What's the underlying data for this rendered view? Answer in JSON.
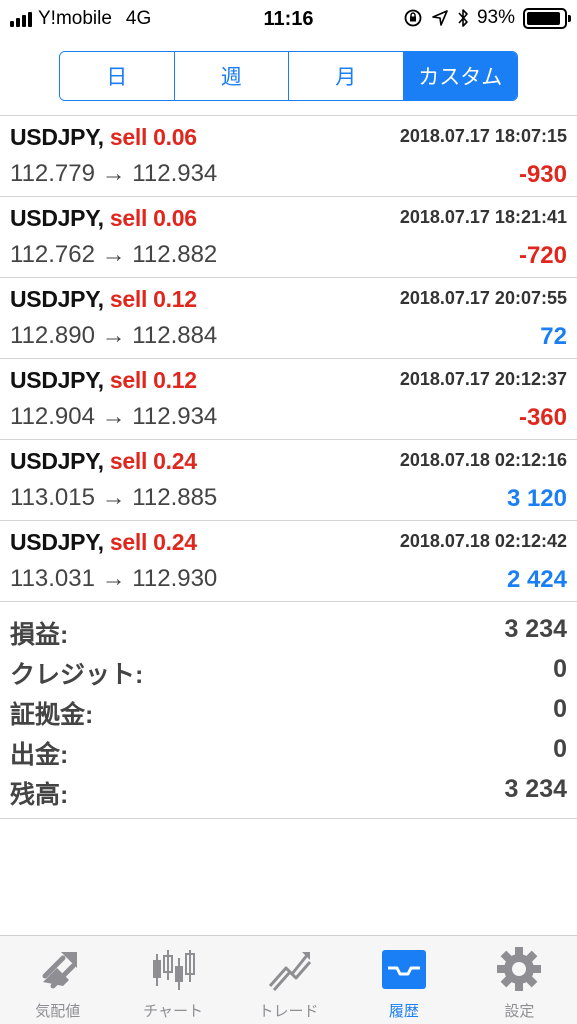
{
  "status_bar": {
    "carrier": "Y!mobile",
    "network": "4G",
    "time": "11:16",
    "battery_percent": "93%",
    "battery_level": 0.93
  },
  "segments": [
    {
      "label": "日",
      "active": false
    },
    {
      "label": "週",
      "active": false
    },
    {
      "label": "月",
      "active": false
    },
    {
      "label": "カスタム",
      "active": true
    }
  ],
  "trades": [
    {
      "symbol": "USDJPY,",
      "side": "sell 0.06",
      "datetime": "2018.07.17 18:07:15",
      "prices": "112.779 → 112.934",
      "profit": "-930",
      "profit_sign": "neg"
    },
    {
      "symbol": "USDJPY,",
      "side": "sell 0.06",
      "datetime": "2018.07.17 18:21:41",
      "prices": "112.762 → 112.882",
      "profit": "-720",
      "profit_sign": "neg"
    },
    {
      "symbol": "USDJPY,",
      "side": "sell 0.12",
      "datetime": "2018.07.17 20:07:55",
      "prices": "112.890 → 112.884",
      "profit": "72",
      "profit_sign": "pos"
    },
    {
      "symbol": "USDJPY,",
      "side": "sell 0.12",
      "datetime": "2018.07.17 20:12:37",
      "prices": "112.904 → 112.934",
      "profit": "-360",
      "profit_sign": "neg"
    },
    {
      "symbol": "USDJPY,",
      "side": "sell 0.24",
      "datetime": "2018.07.18 02:12:16",
      "prices": "113.015 → 112.885",
      "profit": "3 120",
      "profit_sign": "pos"
    },
    {
      "symbol": "USDJPY,",
      "side": "sell 0.24",
      "datetime": "2018.07.18 02:12:42",
      "prices": "113.031 → 112.930",
      "profit": "2 424",
      "profit_sign": "pos"
    }
  ],
  "summary": [
    {
      "label": "損益:",
      "value": "3 234"
    },
    {
      "label": "クレジット:",
      "value": "0"
    },
    {
      "label": "証拠金:",
      "value": "0"
    },
    {
      "label": "出金:",
      "value": "0"
    },
    {
      "label": "残高:",
      "value": "3 234"
    }
  ],
  "tabs": [
    {
      "label": "気配値",
      "icon": "quotes-icon",
      "active": false
    },
    {
      "label": "チャート",
      "icon": "chart-icon",
      "active": false
    },
    {
      "label": "トレード",
      "icon": "trade-icon",
      "active": false
    },
    {
      "label": "履歴",
      "icon": "history-icon",
      "active": true
    },
    {
      "label": "設定",
      "icon": "settings-icon",
      "active": false
    }
  ],
  "colors": {
    "accent": "#1a7ef5",
    "negative": "#e0271e",
    "inactive_tab": "#8e8e93"
  }
}
